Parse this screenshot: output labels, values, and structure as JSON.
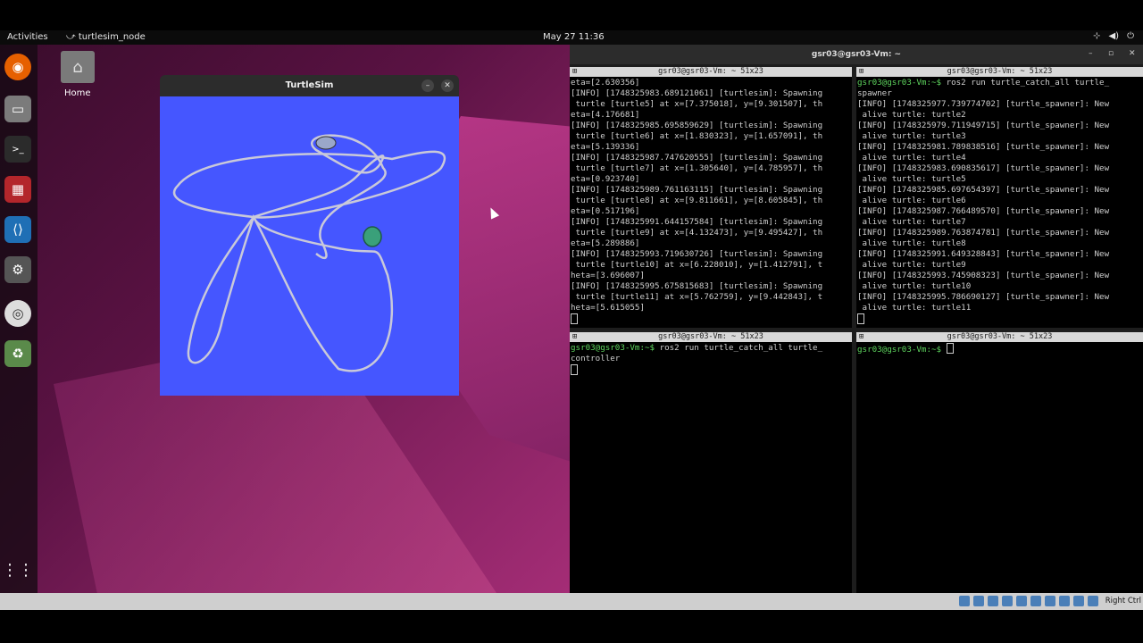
{
  "topbar": {
    "activities": "Activities",
    "app_name": "turtlesim_node",
    "clock": "May 27  11:36",
    "tray": [
      "network-icon",
      "volume-icon",
      "power-icon"
    ]
  },
  "dock": {
    "items": [
      "firefox-icon",
      "files-icon",
      "terminal-icon",
      "system-monitor-icon",
      "vscode-icon",
      "settings-icon",
      "disc-icon",
      "trash-icon",
      "app-grid-icon"
    ]
  },
  "desktop": {
    "home_label": "Home"
  },
  "turtlesim": {
    "title": "TurtleSim",
    "minimize": "–",
    "close": "✕",
    "background": "#4556ff"
  },
  "terminal_window": {
    "title": "gsr03@gsr03-Vm: ~",
    "controls": [
      "–",
      "▫",
      "✕"
    ]
  },
  "panes": [
    {
      "title": "gsr03@gsr03-Vm: ~ 51x23",
      "lines": [
        "eta=[2.630356]",
        "[INFO] [1748325983.689121061] [turtlesim]: Spawning",
        " turtle [turtle5] at x=[7.375018], y=[9.301507], th",
        "eta=[4.176681]",
        "[INFO] [1748325985.695859629] [turtlesim]: Spawning",
        " turtle [turtle6] at x=[1.830323], y=[1.657091], th",
        "eta=[5.139336]",
        "[INFO] [1748325987.747620555] [turtlesim]: Spawning",
        " turtle [turtle7] at x=[1.305640], y=[4.785957], th",
        "eta=[0.923740]",
        "[INFO] [1748325989.761163115] [turtlesim]: Spawning",
        " turtle [turtle8] at x=[9.811661], y=[8.605845], th",
        "eta=[0.517196]",
        "[INFO] [1748325991.644157584] [turtlesim]: Spawning",
        " turtle [turtle9] at x=[4.132473], y=[9.495427], th",
        "eta=[5.289886]",
        "[INFO] [1748325993.719630726] [turtlesim]: Spawning",
        " turtle [turtle10] at x=[6.228010], y=[1.412791], t",
        "heta=[3.696007]",
        "[INFO] [1748325995.675815683] [turtlesim]: Spawning",
        " turtle [turtle11] at x=[5.762759], y=[9.442843], t",
        "heta=[5.615055]"
      ]
    },
    {
      "title": "gsr03@gsr03-Vm: ~ 51x23",
      "prompt": "gsr03@gsr03-Vm:~$",
      "lines": [
        " ros2 run turtle_catch_all turtle_",
        "spawner",
        "[INFO] [1748325977.739774702] [turtle_spawner]: New",
        " alive turtle: turtle2",
        "[INFO] [1748325979.711949715] [turtle_spawner]: New",
        " alive turtle: turtle3",
        "[INFO] [1748325981.789838516] [turtle_spawner]: New",
        " alive turtle: turtle4",
        "[INFO] [1748325983.690835617] [turtle_spawner]: New",
        " alive turtle: turtle5",
        "[INFO] [1748325985.697654397] [turtle_spawner]: New",
        " alive turtle: turtle6",
        "[INFO] [1748325987.766489570] [turtle_spawner]: New",
        " alive turtle: turtle7",
        "[INFO] [1748325989.763874781] [turtle_spawner]: New",
        " alive turtle: turtle8",
        "[INFO] [1748325991.649328843] [turtle_spawner]: New",
        " alive turtle: turtle9",
        "[INFO] [1748325993.745908323] [turtle_spawner]: New",
        " alive turtle: turtle10",
        "[INFO] [1748325995.786690127] [turtle_spawner]: New",
        " alive turtle: turtle11"
      ]
    },
    {
      "title": "gsr03@gsr03-Vm: ~ 51x23",
      "prompt": "gsr03@gsr03-Vm:~$",
      "lines": [
        " ros2 run turtle_catch_all turtle_",
        "controller"
      ]
    },
    {
      "title": "gsr03@gsr03-Vm: ~ 51x23",
      "prompt": "gsr03@gsr03-Vm:~$",
      "lines": [
        " "
      ]
    }
  ],
  "status_bar": {
    "right_ctrl": "Right Ctrl"
  }
}
